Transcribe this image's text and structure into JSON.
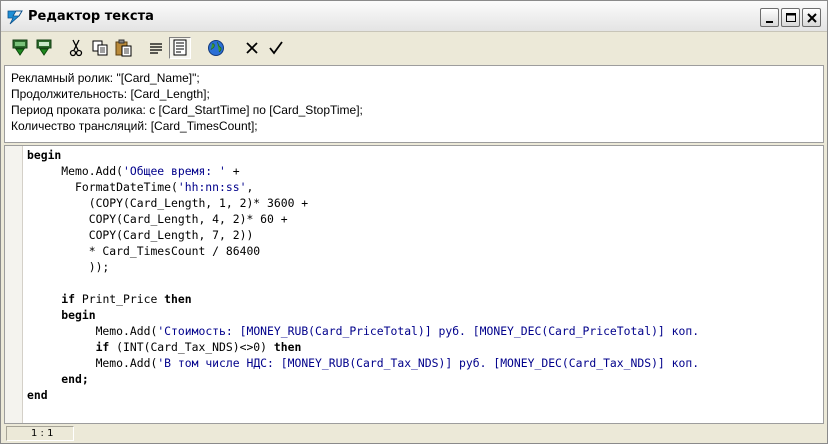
{
  "window": {
    "title": "Редактор текста"
  },
  "toolbar": {
    "buttons": [
      {
        "icon": "insert-field-icon"
      },
      {
        "icon": "insert-field-alt-icon"
      },
      {
        "icon": "cut-icon"
      },
      {
        "icon": "copy-icon"
      },
      {
        "icon": "paste-icon"
      },
      {
        "icon": "text-mode-icon"
      },
      {
        "icon": "script-mode-icon"
      },
      {
        "icon": "globe-icon"
      },
      {
        "icon": "cancel-icon"
      },
      {
        "icon": "ok-icon"
      }
    ]
  },
  "info_text": {
    "lines": [
      "Рекламный ролик: \"[Card_Name]\";",
      "Продолжительность: [Card_Length];",
      "Период проката ролика: с [Card_StartTime] по [Card_StopTime];",
      "Количество трансляций: [Card_TimesCount];"
    ]
  },
  "code": {
    "lines": [
      [
        {
          "t": "begin",
          "c": "kw"
        }
      ],
      [
        {
          "t": "     Memo.Add(",
          "c": ""
        },
        {
          "t": "'Общее время: '",
          "c": "str"
        },
        {
          "t": " +",
          "c": ""
        }
      ],
      [
        {
          "t": "       FormatDateTime(",
          "c": ""
        },
        {
          "t": "'hh:nn:ss'",
          "c": "str"
        },
        {
          "t": ",",
          "c": ""
        }
      ],
      [
        {
          "t": "         (COPY(Card_Length, 1, 2)* 3600 +",
          "c": ""
        }
      ],
      [
        {
          "t": "         COPY(Card_Length, 4, 2)* 60 +",
          "c": ""
        }
      ],
      [
        {
          "t": "         COPY(Card_Length, 7, 2))",
          "c": ""
        }
      ],
      [
        {
          "t": "         * Card_TimesCount / 86400",
          "c": ""
        }
      ],
      [
        {
          "t": "         ));",
          "c": ""
        }
      ],
      [
        {
          "t": "",
          "c": ""
        }
      ],
      [
        {
          "t": "     ",
          "c": ""
        },
        {
          "t": "if",
          "c": "kw"
        },
        {
          "t": " Print_Price ",
          "c": ""
        },
        {
          "t": "then",
          "c": "kw"
        }
      ],
      [
        {
          "t": "     ",
          "c": ""
        },
        {
          "t": "begin",
          "c": "kw"
        }
      ],
      [
        {
          "t": "          Memo.Add(",
          "c": ""
        },
        {
          "t": "'Стоимость: [MONEY_RUB(Card_PriceTotal)] руб. [MONEY_DEC(Card_PriceTotal)] коп.",
          "c": "str"
        }
      ],
      [
        {
          "t": "          ",
          "c": ""
        },
        {
          "t": "if",
          "c": "kw"
        },
        {
          "t": " (INT(Card_Tax_NDS)<>0) ",
          "c": ""
        },
        {
          "t": "then",
          "c": "kw"
        }
      ],
      [
        {
          "t": "          Memo.Add(",
          "c": ""
        },
        {
          "t": "'В том числе НДС: [MONEY_RUB(Card_Tax_NDS)] руб. [MONEY_DEC(Card_Tax_NDS)] коп.",
          "c": "str"
        }
      ],
      [
        {
          "t": "     ",
          "c": ""
        },
        {
          "t": "end;",
          "c": "kw"
        }
      ],
      [
        {
          "t": "end",
          "c": "kw"
        }
      ]
    ]
  },
  "status": {
    "cursor_position": "1 : 1"
  }
}
